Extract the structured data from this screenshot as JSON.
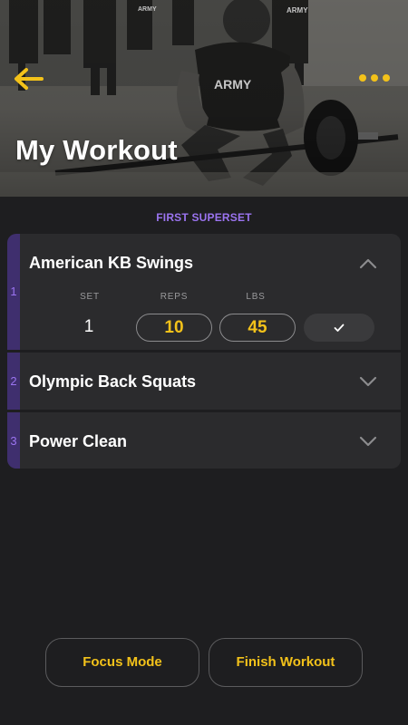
{
  "header": {
    "title": "My Workout",
    "back_icon": "arrow-left-icon",
    "more_icon": "more-dots-icon",
    "accent_color": "#f3c21a"
  },
  "superset": {
    "label": "FIRST SUPERSET",
    "color": "#9b74f0"
  },
  "exercises": [
    {
      "number": "1",
      "name": "American KB Swings",
      "expanded": true,
      "columns": {
        "set": "SET",
        "reps": "REPS",
        "lbs": "LBS"
      },
      "sets": [
        {
          "set": "1",
          "reps": "10",
          "lbs": "45",
          "completed": false
        }
      ]
    },
    {
      "number": "2",
      "name": "Olympic Back Squats",
      "expanded": false
    },
    {
      "number": "3",
      "name": "Power Clean",
      "expanded": false
    }
  ],
  "actions": {
    "focus_mode": "Focus Mode",
    "finish_workout": "Finish Workout"
  }
}
